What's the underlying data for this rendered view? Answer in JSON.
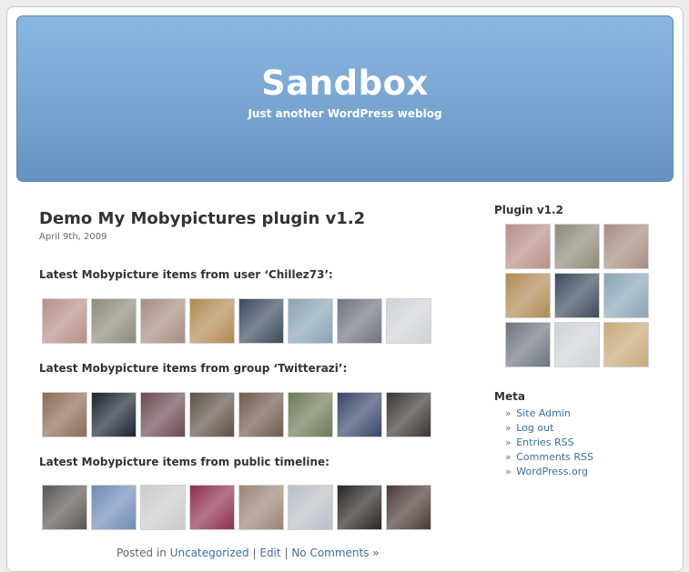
{
  "site": {
    "title": "Sandbox",
    "tagline": "Just another WordPress weblog"
  },
  "post": {
    "title": "Demo My Mobypictures plugin v1.2",
    "date": "April 9th, 2009",
    "sections": [
      {
        "heading": "Latest Mobypicture items from user ‘Chillez73’:",
        "colors": [
          "#b88e86",
          "#8d8a79",
          "#a68d80",
          "#b08a52",
          "#3b4a5c",
          "#8aa3b5",
          "#6d747f",
          "#cfd2d8"
        ]
      },
      {
        "heading": "Latest Mobypicture items from group ‘Twitterazi’:",
        "colors": [
          "#8c6a55",
          "#1a2432",
          "#6b4a52",
          "#5e5046",
          "#6f5a4e",
          "#6c7a55",
          "#39466b",
          "#3c3530"
        ]
      },
      {
        "heading": "Latest Mobypicture items from public timeline:",
        "colors": [
          "#5a5652",
          "#6f8bb8",
          "#c9ccc8",
          "#8c2f4e",
          "#9a8576",
          "#b8bfc6",
          "#2a2520",
          "#4a3a36"
        ]
      }
    ],
    "meta": {
      "posted_in": "Posted in",
      "category": "Uncategorized",
      "sep1": "|",
      "edit": "Edit",
      "sep2": "|",
      "comments": "No Comments »"
    }
  },
  "sidebar": {
    "plugin_title": "Plugin v1.2",
    "plugin_colors": [
      "#b88e86",
      "#8d8a79",
      "#a68d80",
      "#b08a52",
      "#3b4a5c",
      "#8aa3b5",
      "#6d747f",
      "#cfd2d8",
      "#c8a878"
    ],
    "meta_title": "Meta",
    "bullet": "»",
    "meta_links": [
      "Site Admin",
      "Log out",
      "Entries RSS",
      "Comments RSS",
      "WordPress.org"
    ]
  },
  "colors": {
    "link": "#3a6ea5",
    "header_top": "#88b6df",
    "header_bottom": "#6592c0"
  }
}
